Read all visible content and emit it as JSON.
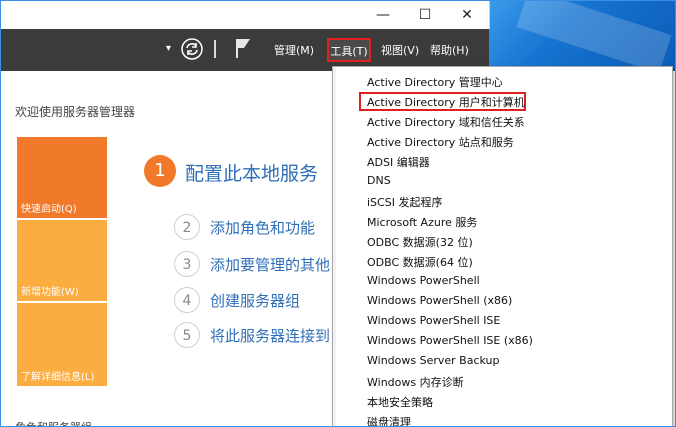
{
  "window": {
    "minimize_glyph": "—",
    "maximize_glyph": "☐",
    "close_glyph": "✕"
  },
  "toolbar": {
    "menus": {
      "manage": "管理(M)",
      "tools": "工具(T)",
      "view": "视图(V)",
      "help": "帮助(H)"
    }
  },
  "main": {
    "welcome": "欢迎使用服务器管理器",
    "tiles": {
      "quick_start": "快速启动(Q)",
      "new_features": "新增功能(W)",
      "learn_more": "了解详细信息(L)"
    },
    "steps": [
      {
        "num": "1",
        "label": "配置此本地服务"
      },
      {
        "num": "2",
        "label": "添加角色和功能"
      },
      {
        "num": "3",
        "label": "添加要管理的其他"
      },
      {
        "num": "4",
        "label": "创建服务器组"
      },
      {
        "num": "5",
        "label": "将此服务器连接到"
      }
    ],
    "roles_heading": "角色和服务器组"
  },
  "tools_menu": {
    "items": [
      "Active Directory 管理中心",
      "Active Directory 用户和计算机",
      "Active Directory 域和信任关系",
      "Active Directory 站点和服务",
      "ADSI 编辑器",
      "DNS",
      "iSCSI 发起程序",
      "Microsoft Azure 服务",
      "ODBC 数据源(32 位)",
      "ODBC 数据源(64 位)",
      "Windows PowerShell",
      "Windows PowerShell (x86)",
      "Windows PowerShell ISE",
      "Windows PowerShell ISE (x86)",
      "Windows Server Backup",
      "Windows 内存诊断",
      "本地安全策略",
      "磁盘清理"
    ],
    "highlighted_index": 1
  },
  "colors": {
    "accent_orange": "#f07a2a",
    "tile_yellow": "#fbad41",
    "link_blue": "#2f6fb8",
    "highlight_red": "#e02020",
    "toolbar_dark": "#3b3b3b"
  }
}
